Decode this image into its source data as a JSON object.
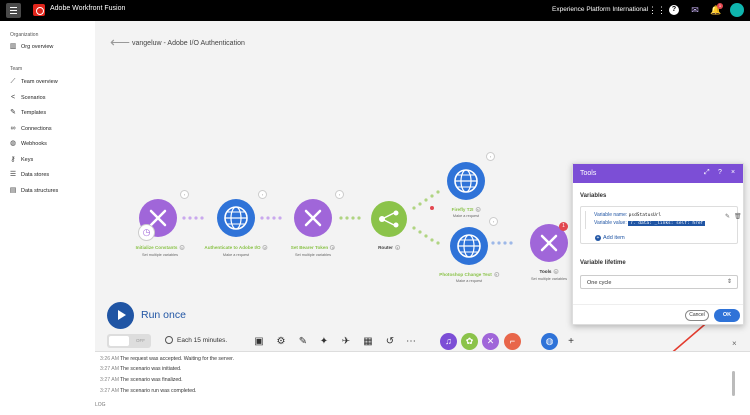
{
  "topbar": {
    "app_title": "Adobe Workfront Fusion",
    "org_name": "Experience Platform International",
    "notification_count": "1"
  },
  "sidebar": {
    "org_section": "Organization",
    "team_section": "Team",
    "items": [
      {
        "label": "Org overview",
        "icon": "org-icon"
      },
      {
        "label": "Team overview",
        "icon": "chart-icon"
      },
      {
        "label": "Scenarios",
        "icon": "share-icon"
      },
      {
        "label": "Templates",
        "icon": "template-icon"
      },
      {
        "label": "Connections",
        "icon": "link-icon"
      },
      {
        "label": "Webhooks",
        "icon": "globe-icon"
      },
      {
        "label": "Keys",
        "icon": "key-icon"
      },
      {
        "label": "Data stores",
        "icon": "database-icon"
      },
      {
        "label": "Data structures",
        "icon": "structure-icon"
      }
    ]
  },
  "scenario": {
    "title": "vangeluw - Adobe I/O Authentication"
  },
  "nodes": [
    {
      "label": "Initialize Constants",
      "num": "1",
      "sub": "Set multiple variables"
    },
    {
      "label": "Authenticate to Adobe I/O",
      "num": "2",
      "sub": "Make a request"
    },
    {
      "label": "Set Bearer Token",
      "num": "3",
      "sub": "Set multiple variables"
    },
    {
      "label": "Router",
      "num": "4",
      "sub": ""
    },
    {
      "label": "Firefly T2I",
      "num": "5",
      "sub": "Make a request"
    },
    {
      "label": "Photoshop Change Text",
      "num": "7",
      "sub": "Make a request"
    },
    {
      "label": "Tools",
      "num": "6",
      "sub": "Set multiple variables"
    }
  ],
  "error_badge": "1",
  "controls": {
    "run_once": "Run once",
    "toggle": "OFF",
    "schedule": "Each 15 minutes."
  },
  "log": {
    "entries": [
      {
        "time": "3:26 AM",
        "text": "The request was accepted. Waiting for the server."
      },
      {
        "time": "3:27 AM",
        "text": "The scenario was initiated."
      },
      {
        "time": "3:27 AM",
        "text": "The scenario was finalized."
      },
      {
        "time": "3:27 AM",
        "text": "The scenario run was completed."
      }
    ],
    "footer": "LOG"
  },
  "dialog": {
    "title": "Tools",
    "variables_label": "Variables",
    "var_name_label": "Variable name:",
    "var_name_value": "psdStatusUrl",
    "var_value_label": "Variable value:",
    "var_value_value": "7. data: _links: self: href",
    "add_item": "Add item",
    "lifetime_label": "Variable lifetime",
    "lifetime_value": "One cycle",
    "cancel": "Cancel",
    "ok": "OK"
  },
  "colors": {
    "purple": "#a066d9",
    "blue": "#2f73d8",
    "green": "#8bc34a",
    "dialog_header": "#7c4ed6",
    "arrow": "#e33b2e"
  }
}
